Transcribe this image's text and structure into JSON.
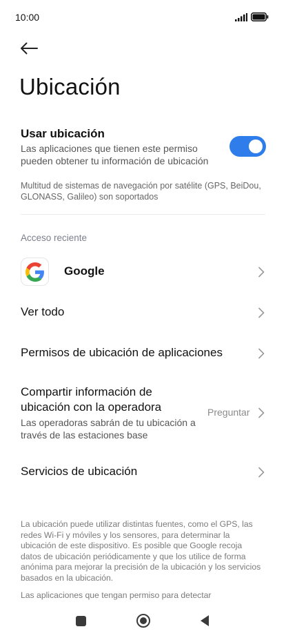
{
  "status_bar": {
    "time": "10:00",
    "signal_icon": "signal-icon",
    "battery_icon": "battery-icon"
  },
  "back_icon": "arrow-left-icon",
  "title": "Ubicación",
  "use_location": {
    "title": "Usar ubicación",
    "description": "Las aplicaciones que tienen este permiso pueden obtener tu información de ubicación",
    "enabled": true,
    "toggle_color": "#2f7dea"
  },
  "gnss_note": "Multitud de sistemas de navegación por satélite (GPS, BeiDou, GLONASS, Galileo) son soportados",
  "recent_access": {
    "header": "Acceso reciente",
    "apps": [
      {
        "name": "Google",
        "icon": "google-logo-icon"
      }
    ]
  },
  "items": {
    "see_all": "Ver todo",
    "app_permissions": "Permisos de ubicación de aplicaciones",
    "share_with_carrier": {
      "title": "Compartir información de ubicación con la operadora",
      "description": "Las operadoras sabrán de tu ubicación a través de las estaciones base",
      "value": "Preguntar"
    },
    "location_services": "Servicios de ubicación"
  },
  "footer": {
    "paragraph1": "La ubicación puede utilizar distintas fuentes, como el GPS, las redes Wi-Fi y móviles y los sensores, para determinar la ubicación de este dispositivo. Es posible que Google recoja datos de ubicación periódicamente y que los utilice de forma anónima para mejorar la precisión de la ubicación y los servicios basados en la ubicación.",
    "paragraph2": "Las aplicaciones que tengan permiso para detectar"
  },
  "nav_bar": {
    "recents_icon": "square-icon",
    "home_icon": "circle-home-icon",
    "back_icon": "triangle-back-icon"
  }
}
